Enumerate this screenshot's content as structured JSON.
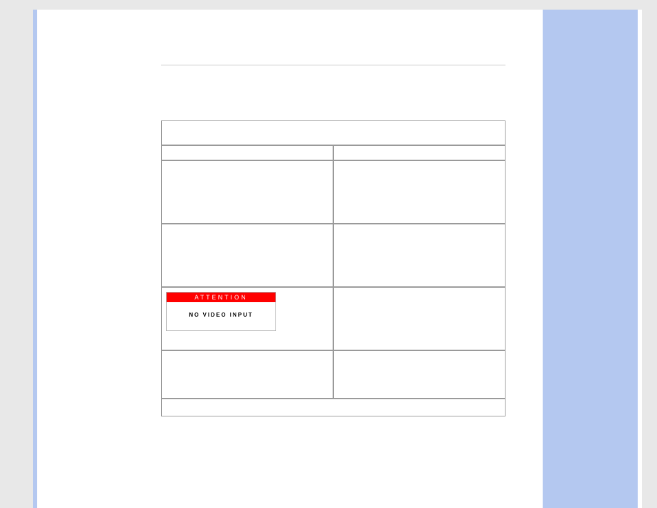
{
  "osd": {
    "title": "ATTENTION",
    "message": "NO VIDEO INPUT"
  },
  "table": {
    "title": "",
    "head_left": "",
    "head_right": "",
    "rows": [
      {
        "left": "",
        "right": ""
      },
      {
        "left": "",
        "right": ""
      },
      {
        "left": "",
        "right": ""
      },
      {
        "left": "",
        "right": ""
      }
    ],
    "footer": ""
  }
}
